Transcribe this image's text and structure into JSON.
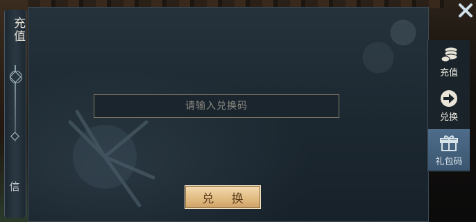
{
  "left_panel": {
    "title": "充值",
    "bottom_char": "信"
  },
  "redeem": {
    "placeholder": "请输入兑换码",
    "button_label": "兑 换"
  },
  "tabs": [
    {
      "label": "充值",
      "icon": "coins-icon",
      "active": false
    },
    {
      "label": "兑换",
      "icon": "exchange-icon",
      "active": false
    },
    {
      "label": "礼包码",
      "icon": "gift-icon",
      "active": true
    }
  ],
  "colors": {
    "button_gold": "#e2bd84",
    "active_tab": "#4e6d8a",
    "panel_bg": "#1c2830"
  }
}
